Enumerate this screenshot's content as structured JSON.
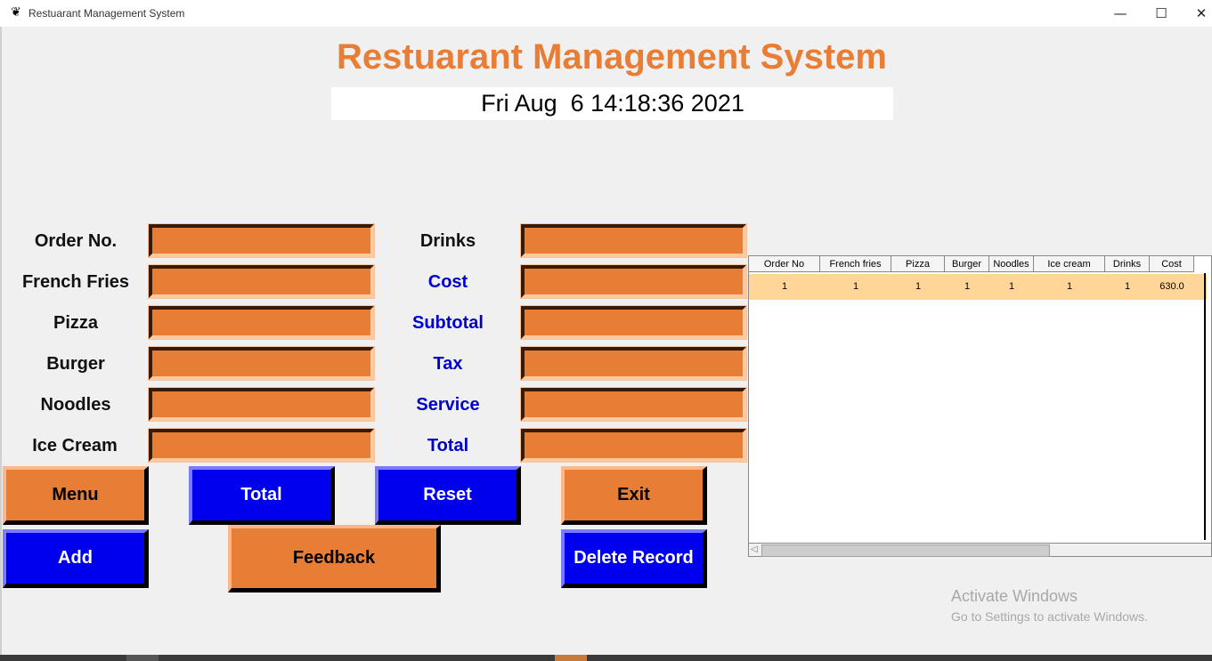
{
  "window": {
    "title": "Restuarant Management System",
    "minimize_icon": "—",
    "maximize_icon": "☐",
    "close_icon": "✕",
    "app_icon": "feather-icon"
  },
  "header": {
    "title": "Restuarant Management System",
    "datetime": "Fri Aug  6 14:18:36 2021"
  },
  "form": {
    "left_labels": [
      "Order No.",
      "French Fries",
      "Pizza",
      "Burger",
      "Noodles",
      "Ice Cream"
    ],
    "right_labels": [
      "Drinks",
      "Cost",
      "Subtotal",
      "Tax",
      "Service",
      "Total"
    ],
    "left_values": [
      "",
      "",
      "",
      "",
      "",
      ""
    ],
    "right_values": [
      "",
      "",
      "",
      "",
      "",
      ""
    ]
  },
  "buttons": {
    "menu": "Menu",
    "total": "Total",
    "reset": "Reset",
    "exit": "Exit",
    "add": "Add",
    "feedback": "Feedback",
    "delete_record": "Delete Record"
  },
  "table": {
    "columns": [
      "Order No",
      "French fries",
      "Pizza",
      "Burger",
      "Noodles",
      "Ice cream",
      "Drinks",
      "Cost"
    ],
    "rows": [
      [
        "1",
        "1",
        "1",
        "1",
        "1",
        "1",
        "1",
        "630.0"
      ]
    ]
  },
  "watermark": {
    "line1": "Activate Windows",
    "line2": "Go to Settings to activate Windows."
  },
  "colors": {
    "accent_orange": "#e87e35",
    "button_blue": "#0000ee",
    "label_blue": "#0000cc",
    "row_highlight": "#ffd698"
  }
}
